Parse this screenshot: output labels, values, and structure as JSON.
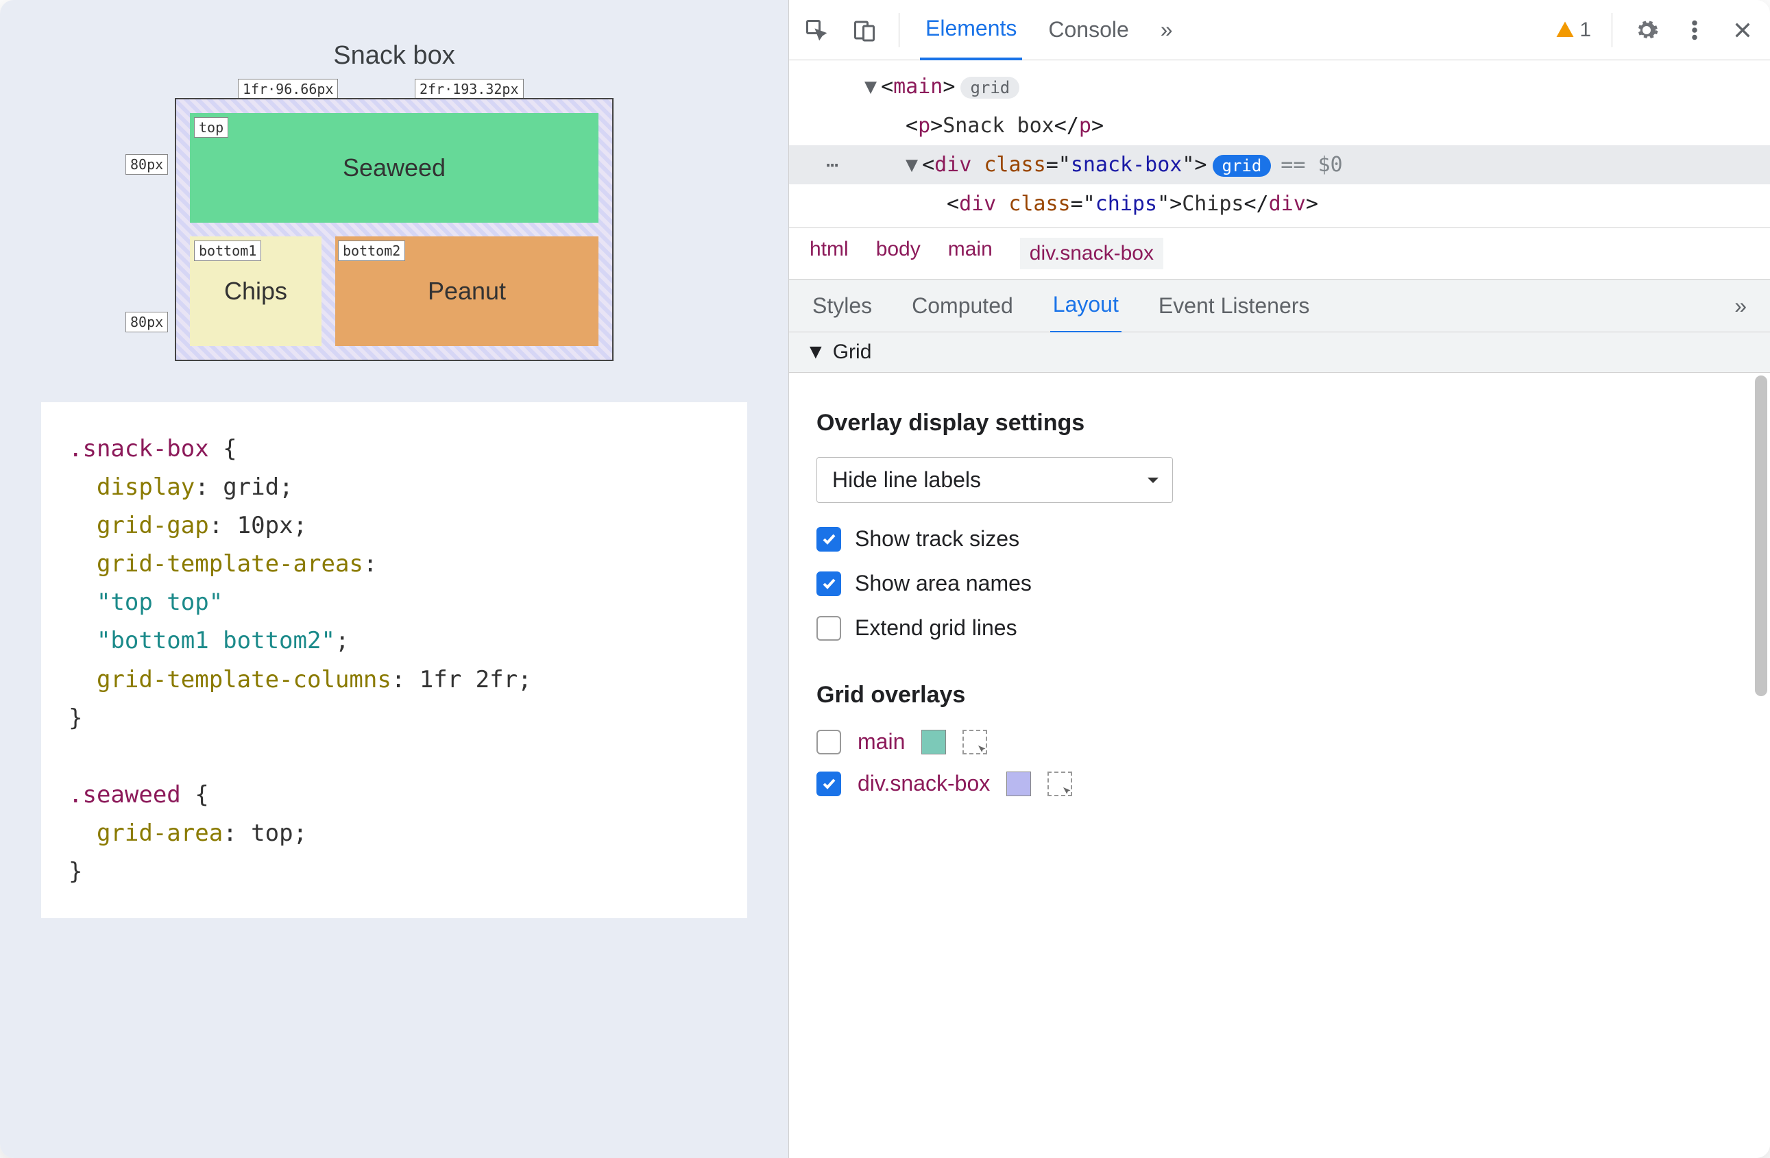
{
  "page": {
    "title": "Snack box",
    "grid": {
      "col_labels": [
        "1fr·96.66px",
        "2fr·193.32px"
      ],
      "row_labels": [
        "80px",
        "80px"
      ],
      "area_labels": [
        "top",
        "bottom1",
        "bottom2"
      ],
      "cells": {
        "seaweed": "Seaweed",
        "chips": "Chips",
        "peanut": "Peanut"
      }
    },
    "css": {
      "l1": ".snack-box",
      "l2_p": "display",
      "l2_v": "grid",
      "l3_p": "grid-gap",
      "l3_v": "10px",
      "l4_p": "grid-template-areas",
      "l5_v": "\"top top\"",
      "l6_v": "\"bottom1 bottom2\"",
      "l7_p": "grid-template-columns",
      "l7_v": "1fr 2fr",
      "l8": ".seaweed",
      "l9_p": "grid-area",
      "l9_v": "top"
    }
  },
  "devtools": {
    "tabs": {
      "elements": "Elements",
      "console": "Console",
      "more": "»"
    },
    "warning_count": "1",
    "dom": {
      "main_open": "main",
      "grid_badge": "grid",
      "p_text": "Snack box",
      "div_class": "snack-box",
      "selected_suffix": "== $0",
      "chips_class": "chips",
      "chips_text": "Chips"
    },
    "breadcrumbs": [
      "html",
      "body",
      "main",
      "div.snack-box"
    ],
    "subtabs": {
      "styles": "Styles",
      "computed": "Computed",
      "layout": "Layout",
      "listeners": "Event Listeners",
      "more": "»"
    },
    "grid_section": "Grid",
    "overlay_settings_title": "Overlay display settings",
    "line_labels_select": "Hide line labels",
    "checkboxes": {
      "track_sizes": "Show track sizes",
      "area_names": "Show area names",
      "extend_lines": "Extend grid lines"
    },
    "overlays_title": "Grid overlays",
    "overlays": [
      {
        "name": "main",
        "checked": false,
        "color": "#7cc9b8"
      },
      {
        "name": "div.snack-box",
        "checked": true,
        "color": "#b8b8f0"
      }
    ]
  }
}
